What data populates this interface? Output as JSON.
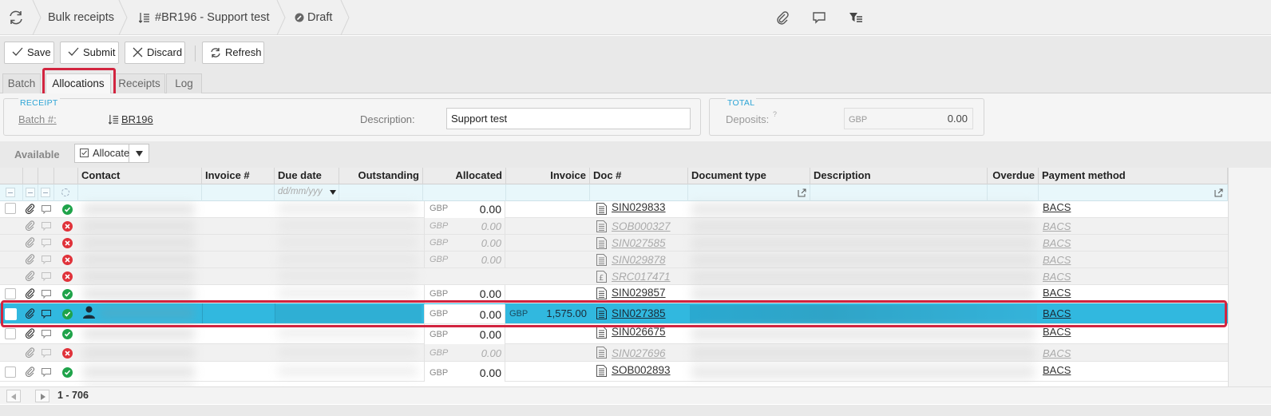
{
  "breadcrumb": {
    "module": "Bulk receipts",
    "record": "#BR196 - Support test",
    "status": "Draft"
  },
  "toolbar": {
    "save": "Save",
    "submit": "Submit",
    "discard": "Discard",
    "refresh": "Refresh"
  },
  "tabs": [
    "Batch",
    "Allocations",
    "Receipts",
    "Log"
  ],
  "receipt": {
    "legend": "RECEIPT",
    "batch_label": "Batch #:",
    "batch_value": "BR196",
    "description_label": "Description:",
    "description_value": "Support test"
  },
  "total": {
    "legend": "TOTAL",
    "deposits_label": "Deposits:",
    "deposits_hint": "?",
    "currency": "GBP",
    "deposits_value": "0.00"
  },
  "grid_toolbar": {
    "available": "Available",
    "allocate": "Allocate"
  },
  "columns": {
    "contact": "Contact",
    "invoice_no": "Invoice #",
    "due_date": "Due date",
    "outstanding": "Outstanding",
    "allocated": "Allocated",
    "invoice": "Invoice",
    "doc_no": "Doc #",
    "document_type": "Document type",
    "description": "Description",
    "overdue": "Overdue",
    "payment_method": "Payment method"
  },
  "filter": {
    "due_date_placeholder": "dd/mm/yyy"
  },
  "rows": [
    {
      "status": "ok",
      "dim": false,
      "currency": "GBP",
      "allocated": "0.00",
      "invoice": "",
      "doc": "SIN029833",
      "payment": "BACS"
    },
    {
      "status": "err",
      "dim": true,
      "currency": "GBP",
      "allocated": "0.00",
      "invoice": "",
      "doc": "SOB000327",
      "payment": "BACS"
    },
    {
      "status": "err",
      "dim": true,
      "currency": "GBP",
      "allocated": "0.00",
      "invoice": "",
      "doc": "SIN027585",
      "payment": "BACS"
    },
    {
      "status": "err",
      "dim": true,
      "currency": "GBP",
      "allocated": "0.00",
      "invoice": "",
      "doc": "SIN029878",
      "payment": "BACS"
    },
    {
      "status": "err",
      "dim": true,
      "currency": "",
      "allocated": "",
      "invoice": "",
      "doc": "SRC017471",
      "payment": "BACS"
    },
    {
      "status": "ok",
      "dim": false,
      "currency": "GBP",
      "allocated": "0.00",
      "invoice": "",
      "doc": "SIN029857",
      "payment": "BACS"
    },
    {
      "status": "ok",
      "dim": false,
      "selected": true,
      "currency": "GBP",
      "allocated": "0.00",
      "invoice_currency": "GBP",
      "invoice": "1,575.00",
      "doc": "SIN027385",
      "payment": "BACS"
    },
    {
      "status": "ok",
      "dim": false,
      "currency": "GBP",
      "allocated": "0.00",
      "invoice": "",
      "doc": "SIN026675",
      "payment": "BACS"
    },
    {
      "status": "err",
      "dim": true,
      "currency": "GBP",
      "allocated": "0.00",
      "invoice": "",
      "doc": "SIN027696",
      "payment": "BACS"
    },
    {
      "status": "ok",
      "dim": false,
      "currency": "GBP",
      "allocated": "0.00",
      "invoice": "",
      "doc": "SOB002893",
      "payment": "BACS"
    }
  ],
  "pager": {
    "range": "1 - 706"
  }
}
